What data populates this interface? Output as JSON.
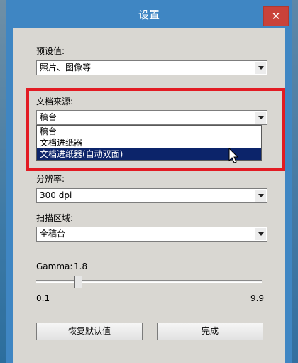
{
  "window": {
    "title": "设置",
    "close_glyph": "✕"
  },
  "preset": {
    "label": "预设值:",
    "value": "照片、图像等"
  },
  "source": {
    "label": "文档来源:",
    "value": "稿台",
    "options": [
      "稿台",
      "文档进纸器",
      "文档进纸器(自动双面)"
    ],
    "highlighted_index": 2
  },
  "resolution": {
    "label": "分辨率:",
    "value": "300 dpi"
  },
  "scan_area": {
    "label": "扫描区域:",
    "value": "全稿台"
  },
  "gamma": {
    "label": "Gamma:",
    "value": "1.8",
    "min": "0.1",
    "max": "9.9",
    "level": 1.8
  },
  "buttons": {
    "reset": "恢复默认值",
    "done": "完成"
  },
  "colors": {
    "title_bar": "#3f86c3",
    "close": "#c9423a",
    "highlight": "#0c246a",
    "annotation": "#e21b23"
  }
}
